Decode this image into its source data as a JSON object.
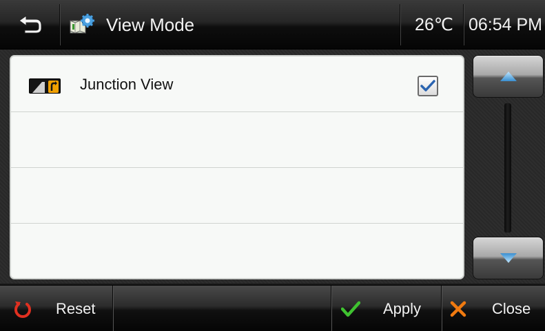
{
  "header": {
    "title": "View Mode",
    "temperature": "26℃",
    "time": "06:54 PM",
    "icons": {
      "back": "back-arrow-icon",
      "title": "view-mode-settings-icon"
    }
  },
  "list": {
    "items": [
      {
        "label": "Junction View",
        "icon": "junction-view-icon",
        "checked": true
      },
      {
        "label": ""
      },
      {
        "label": ""
      },
      {
        "label": ""
      }
    ]
  },
  "scroll": {
    "up_icon": "arrow-up-icon",
    "down_icon": "arrow-down-icon"
  },
  "footer": {
    "reset_label": "Reset",
    "apply_label": "Apply",
    "close_label": "Close",
    "icons": {
      "reset": "reset-icon",
      "apply": "checkmark-icon",
      "close": "close-icon"
    }
  },
  "colors": {
    "accent_blue": "#3a8fd0",
    "apply_green": "#3fc230",
    "close_orange": "#f07a10",
    "reset_red": "#e03020",
    "junction_icon_orange": "#f0a000"
  }
}
